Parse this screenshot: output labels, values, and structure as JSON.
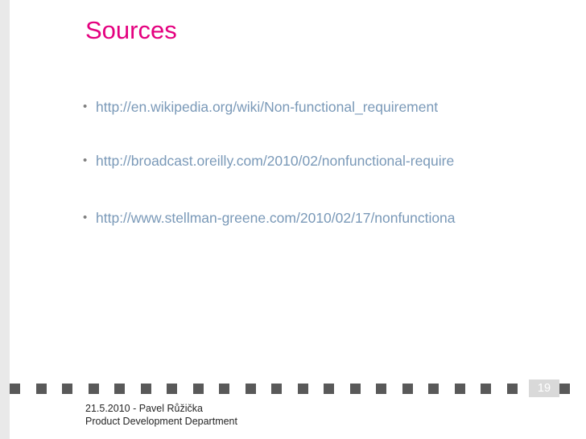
{
  "slide": {
    "title": "Sources",
    "bullets": [
      {
        "marker": "•",
        "text": "http://en.wikipedia.org/wiki/Non-functional_requirement"
      },
      {
        "marker": "•",
        "text": "http://broadcast.oreilly.com/2010/02/nonfunctional-require"
      },
      {
        "marker": "•",
        "text": "http://www.stellman-greene.com/2010/02/17/nonfunctiona"
      }
    ],
    "page_number": "19",
    "footer": {
      "line1": "21.5.2010  -  Pavel Růžička",
      "line2": "Product Development Department"
    },
    "colors": {
      "title": "#e4007f",
      "link": "#7a99b8",
      "dot_square": "#595959",
      "page_box": "#d9d9d9",
      "left_bar": "#e9e9e9"
    }
  }
}
